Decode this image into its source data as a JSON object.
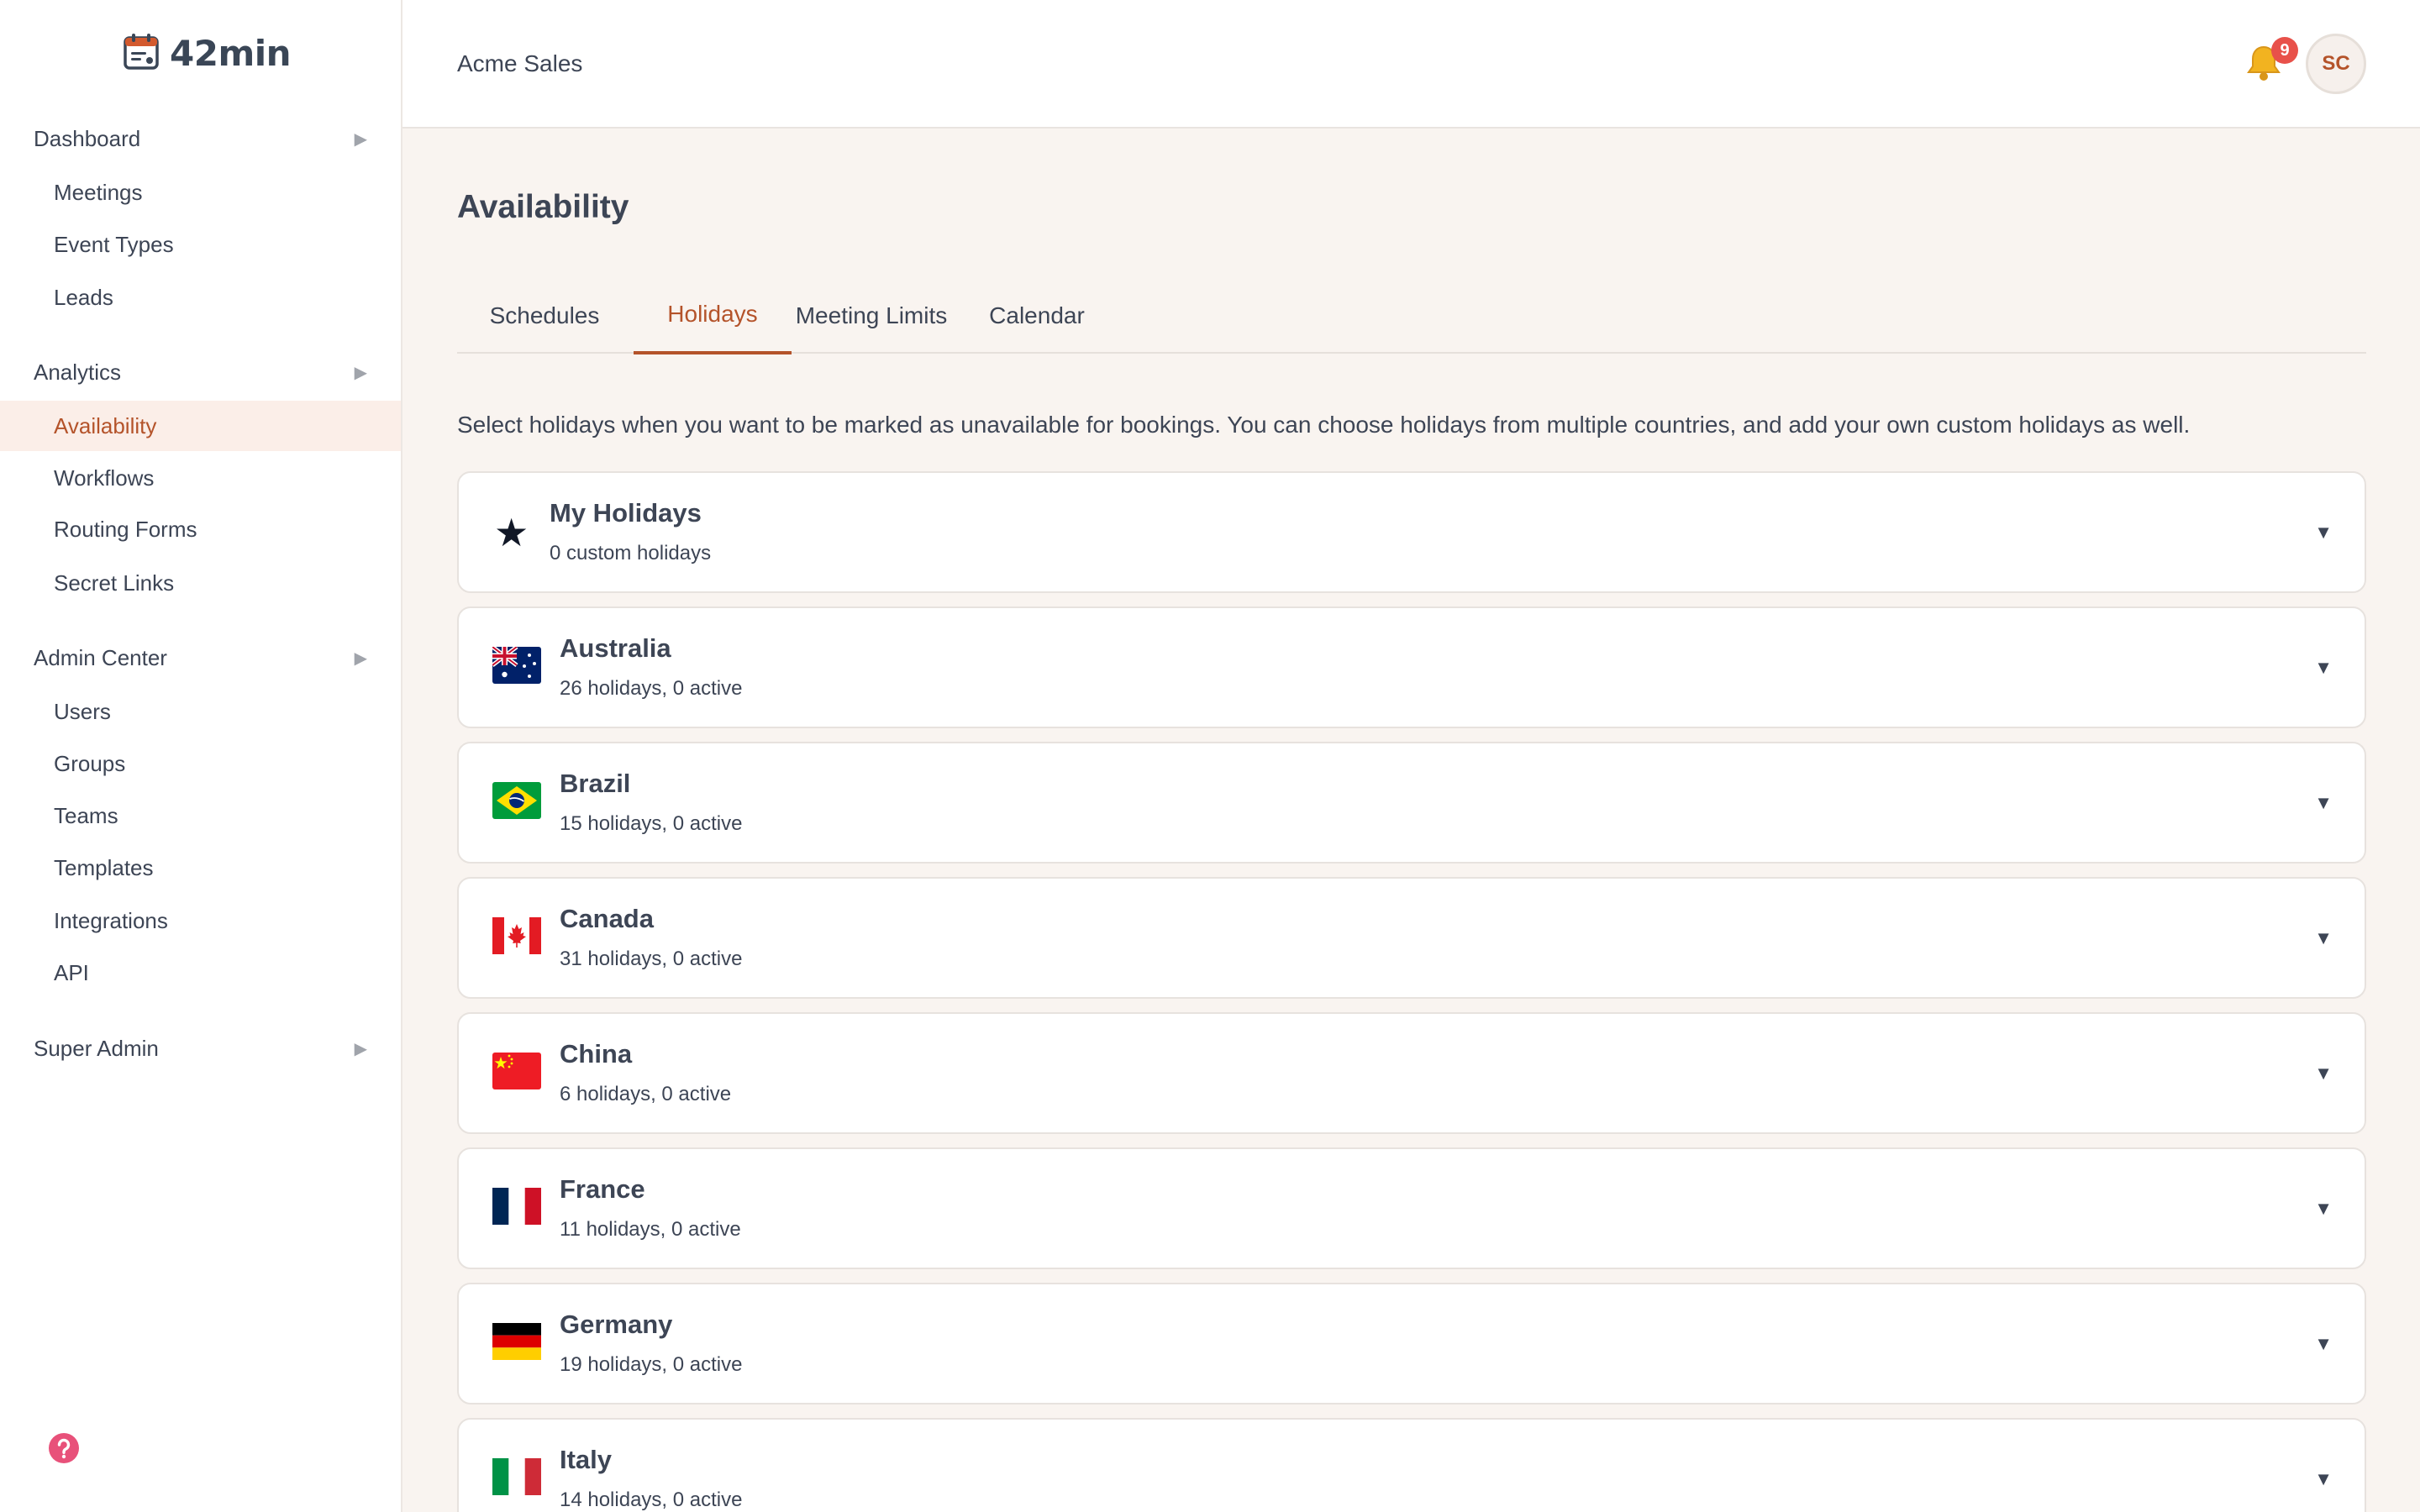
{
  "app": {
    "name": "42min"
  },
  "sidebar": {
    "sections": [
      {
        "label": "Dashboard",
        "items": [
          "Meetings",
          "Event Types",
          "Leads"
        ]
      },
      {
        "label": "Analytics",
        "items": [
          "Availability",
          "Workflows",
          "Routing Forms",
          "Secret Links"
        ]
      },
      {
        "label": "Admin Center",
        "items": [
          "Users",
          "Groups",
          "Teams",
          "Templates",
          "Integrations",
          "API"
        ]
      },
      {
        "label": "Super Admin",
        "items": []
      }
    ],
    "active_item": "Availability"
  },
  "header": {
    "org_name": "Acme Sales",
    "notification_count": "9",
    "avatar_initials": "SC"
  },
  "page": {
    "title": "Availability",
    "tabs": [
      "Schedules",
      "Holidays",
      "Meeting Limits",
      "Calendar"
    ],
    "active_tab": "Holidays",
    "intro": "Select holidays when you want to be marked as unavailable for bookings. You can choose holidays from multiple countries, and add your own custom holidays as well."
  },
  "holiday_groups": [
    {
      "name": "My Holidays",
      "summary": "0 custom holidays",
      "icon": "star-icon"
    },
    {
      "name": "Australia",
      "summary": "26 holidays, 0 active",
      "icon": "flag-australia-icon"
    },
    {
      "name": "Brazil",
      "summary": "15 holidays, 0 active",
      "icon": "flag-brazil-icon"
    },
    {
      "name": "Canada",
      "summary": "31 holidays, 0 active",
      "icon": "flag-canada-icon"
    },
    {
      "name": "China",
      "summary": "6 holidays, 0 active",
      "icon": "flag-china-icon"
    },
    {
      "name": "France",
      "summary": "11 holidays, 0 active",
      "icon": "flag-france-icon"
    },
    {
      "name": "Germany",
      "summary": "19 holidays, 0 active",
      "icon": "flag-germany-icon"
    },
    {
      "name": "Italy",
      "summary": "14 holidays, 0 active",
      "icon": "flag-italy-icon"
    }
  ],
  "glyphs": {
    "chevron_right": "▶",
    "caret_down": "▼",
    "star": "★"
  },
  "colors": {
    "accent": "#b4532a",
    "active_bg": "#fbeee8",
    "badge": "#e8514a",
    "page_bg": "#f9f4f0"
  }
}
